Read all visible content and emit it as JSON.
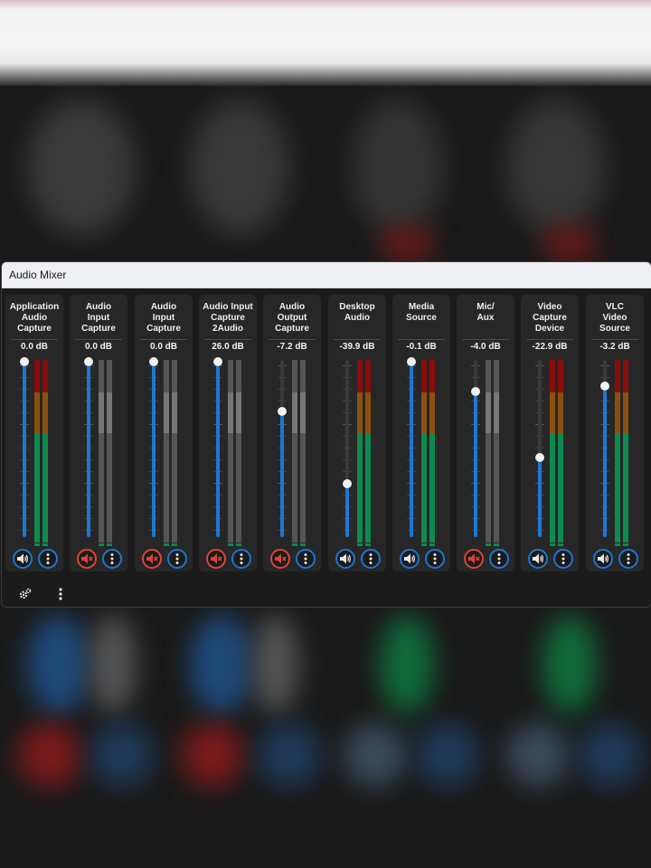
{
  "window": {
    "title": "Audio Mixer"
  },
  "colors": {
    "accent": "#1d76d2",
    "muted": "#d9443a",
    "meter_green": "#0f8a4e",
    "meter_yellow": "#8a5010",
    "meter_red": "#8a0c0c"
  },
  "channels": [
    {
      "name": "Application\nAudio\nCapture",
      "db": "0.0 dB",
      "fader_level": 1.0,
      "muted": false,
      "meter_active": true
    },
    {
      "name": "Audio\nInput\nCapture",
      "db": "0.0 dB",
      "fader_level": 1.0,
      "muted": true,
      "meter_active": false
    },
    {
      "name": "Audio\nInput\nCapture",
      "db": "0.0 dB",
      "fader_level": 1.0,
      "muted": true,
      "meter_active": false
    },
    {
      "name": "Audio Input\nCapture\n2Audio",
      "db": "26.0 dB",
      "fader_level": 1.0,
      "muted": true,
      "meter_active": false
    },
    {
      "name": "Audio\nOutput\nCapture",
      "db": "-7.2 dB",
      "fader_level": 0.72,
      "muted": true,
      "meter_active": false
    },
    {
      "name": "Desktop\nAudio",
      "db": "-39.9 dB",
      "fader_level": 0.31,
      "muted": false,
      "meter_active": true
    },
    {
      "name": "Media\nSource",
      "db": "-0.1 dB",
      "fader_level": 1.0,
      "muted": false,
      "meter_active": true
    },
    {
      "name": "Mic/\nAux",
      "db": "-4.0 dB",
      "fader_level": 0.83,
      "muted": true,
      "meter_active": false
    },
    {
      "name": "Video\nCapture\nDevice",
      "db": "-22.9 dB",
      "fader_level": 0.46,
      "muted": false,
      "meter_active": true
    },
    {
      "name": "VLC\nVideo\nSource",
      "db": "-3.2 dB",
      "fader_level": 0.86,
      "muted": false,
      "meter_active": true
    }
  ],
  "icons": {
    "volume": "speaker-icon",
    "mute": "speaker-muted-icon",
    "menu": "vertical-dots-icon",
    "settings": "gears-icon"
  }
}
